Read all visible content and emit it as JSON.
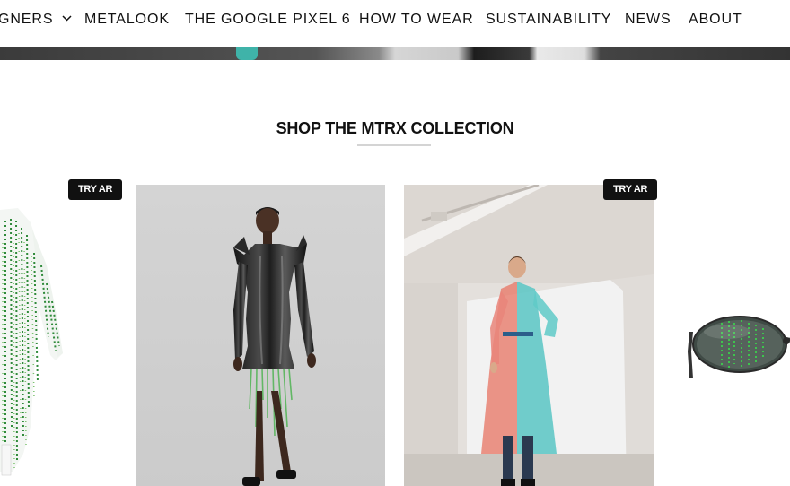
{
  "nav": {
    "items": [
      {
        "label": "GNERS"
      },
      {
        "label": "METALOOK"
      },
      {
        "label": "THE GOOGLE PIXEL 6"
      },
      {
        "label": "HOW TO WEAR"
      },
      {
        "label": "SUSTAINABILITY"
      },
      {
        "label": "NEWS"
      },
      {
        "label": "ABOUT"
      }
    ]
  },
  "collection": {
    "title": "SHOP THE MTRX COLLECTION",
    "badge_label": "TRY AR",
    "products": [
      {
        "image": "green-sequin-dress",
        "has_ar": true
      },
      {
        "image": "black-latex-dress",
        "has_ar": false
      },
      {
        "image": "transparent-colorblock-coat",
        "has_ar": true
      },
      {
        "image": "matrix-sunglasses",
        "has_ar": false
      }
    ]
  },
  "colors": {
    "text": "#111111",
    "badge_bg": "#111111",
    "badge_text": "#ffffff",
    "underline": "#d4d4d4"
  }
}
